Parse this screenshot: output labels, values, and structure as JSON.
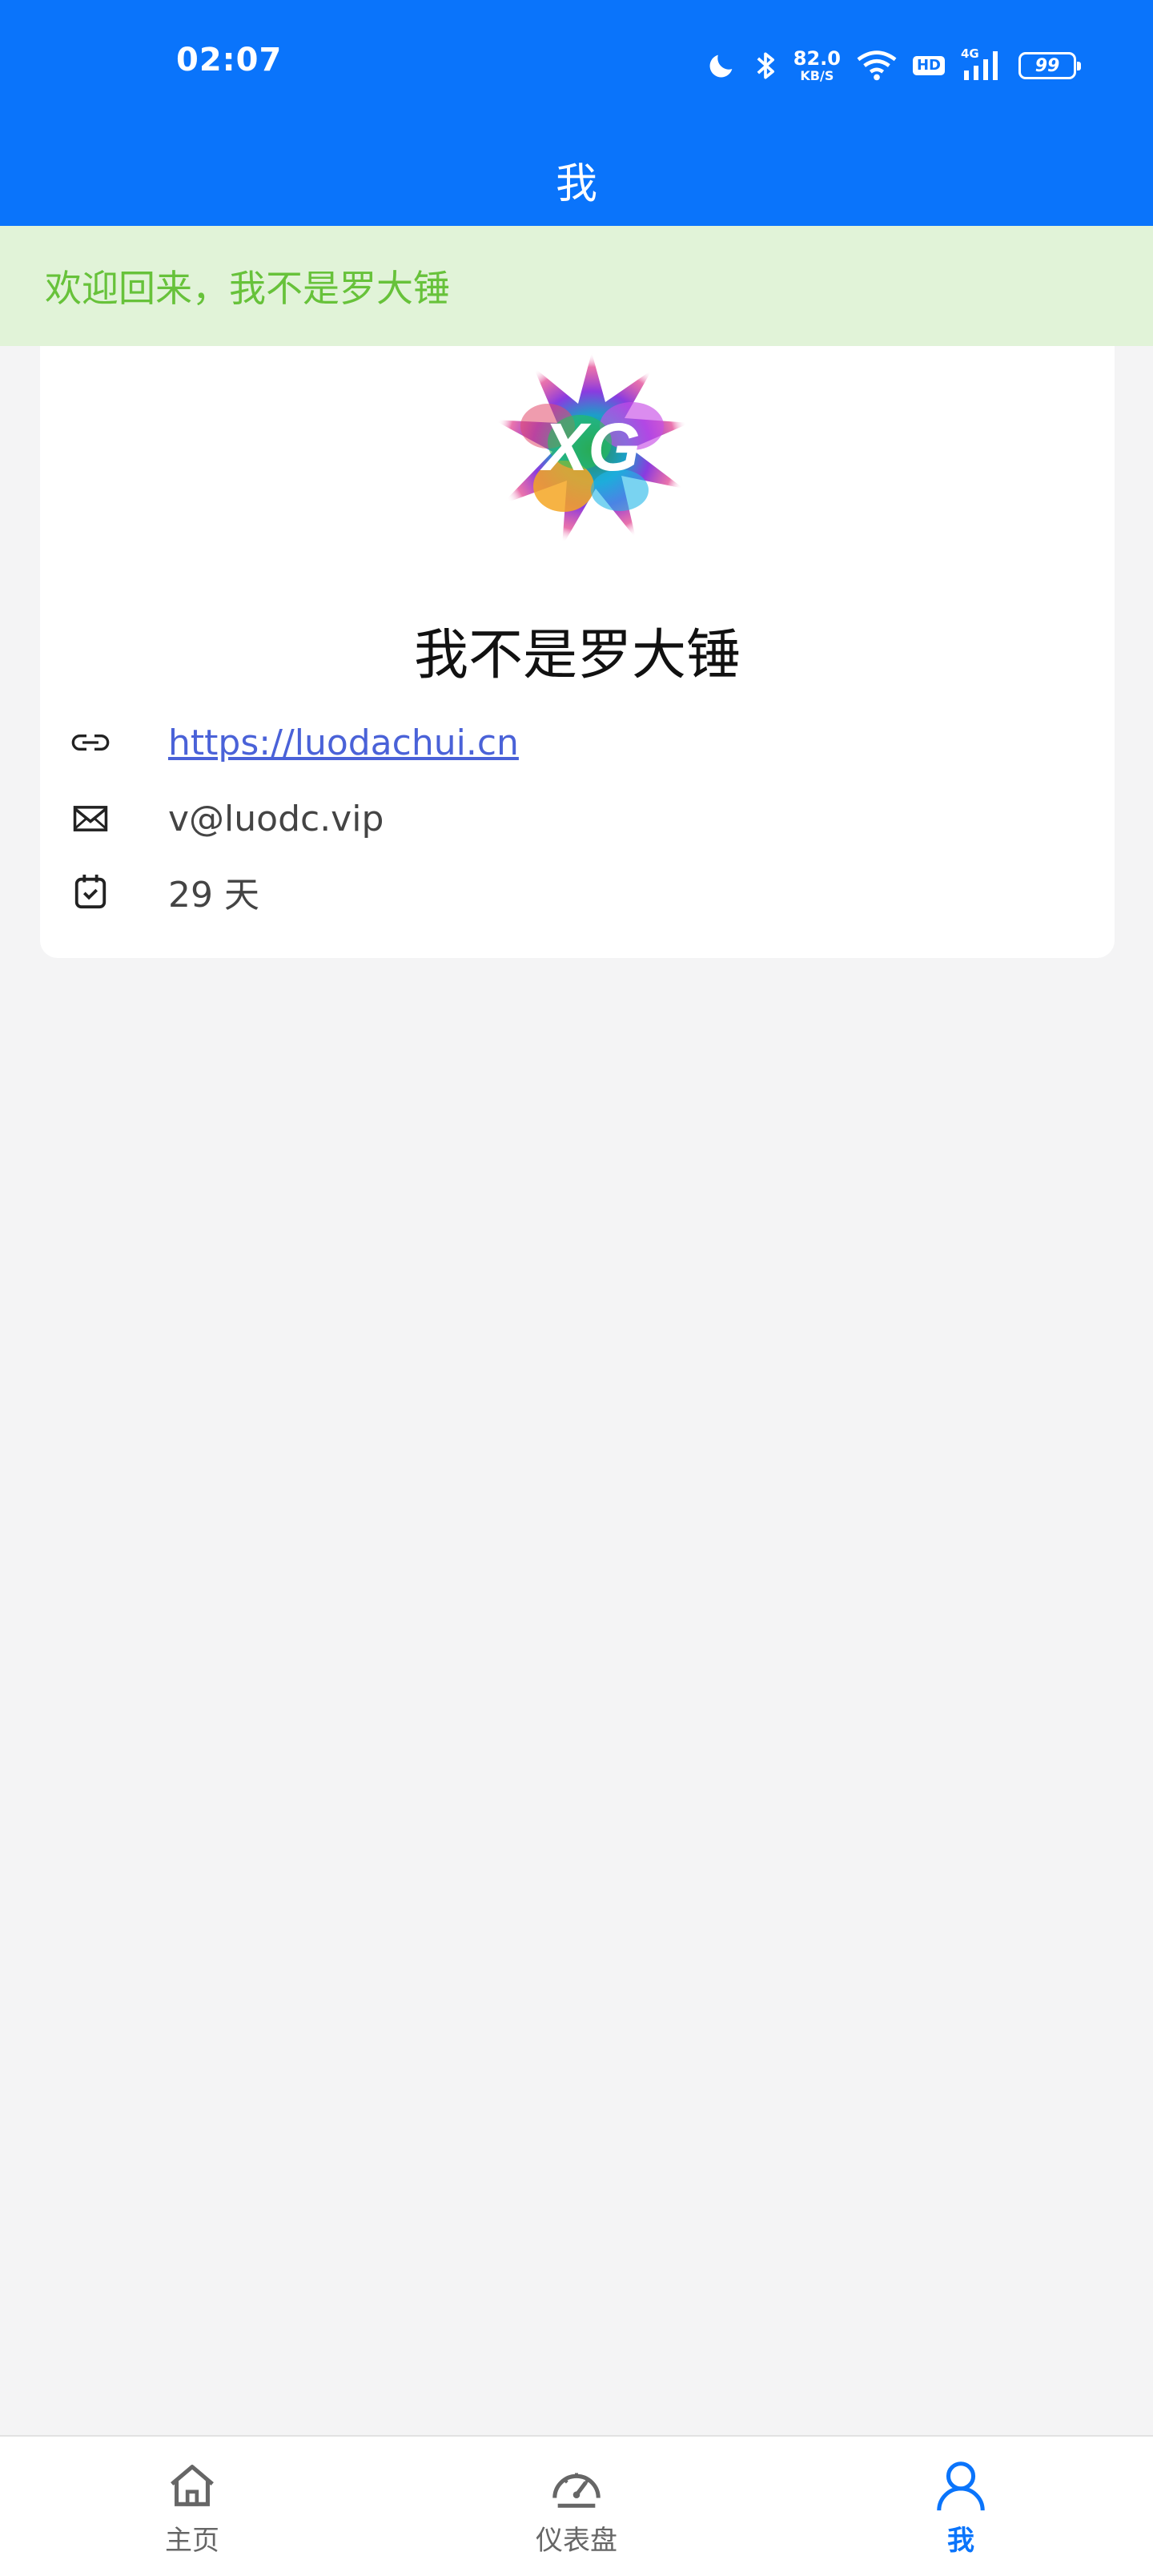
{
  "status_bar": {
    "time": "02:07",
    "net_speed_value": "82.0",
    "net_speed_unit": "KB/S",
    "hd_label": "HD",
    "signal_label": "4G",
    "battery_level": "99",
    "icons": [
      "moon-icon",
      "bluetooth-icon",
      "wifi-icon",
      "signal-icon",
      "battery-icon"
    ]
  },
  "nav": {
    "title": "我"
  },
  "welcome": {
    "text": "欢迎回来，我不是罗大锤"
  },
  "profile": {
    "avatar_text": "XG",
    "name": "我不是罗大锤",
    "website": "https://luodachui.cn",
    "email": "v@luodc.vip",
    "days": "29 天"
  },
  "tabs": [
    {
      "label": "主页",
      "icon": "home-icon",
      "active": false
    },
    {
      "label": "仪表盘",
      "icon": "dashboard-icon",
      "active": false
    },
    {
      "label": "我",
      "icon": "user-icon",
      "active": true
    }
  ],
  "colors": {
    "primary": "#0a74fb",
    "welcome_bg": "#e1f3d8",
    "welcome_text": "#67c23a",
    "link": "#4a62d8",
    "page_bg": "#f4f4f5"
  }
}
